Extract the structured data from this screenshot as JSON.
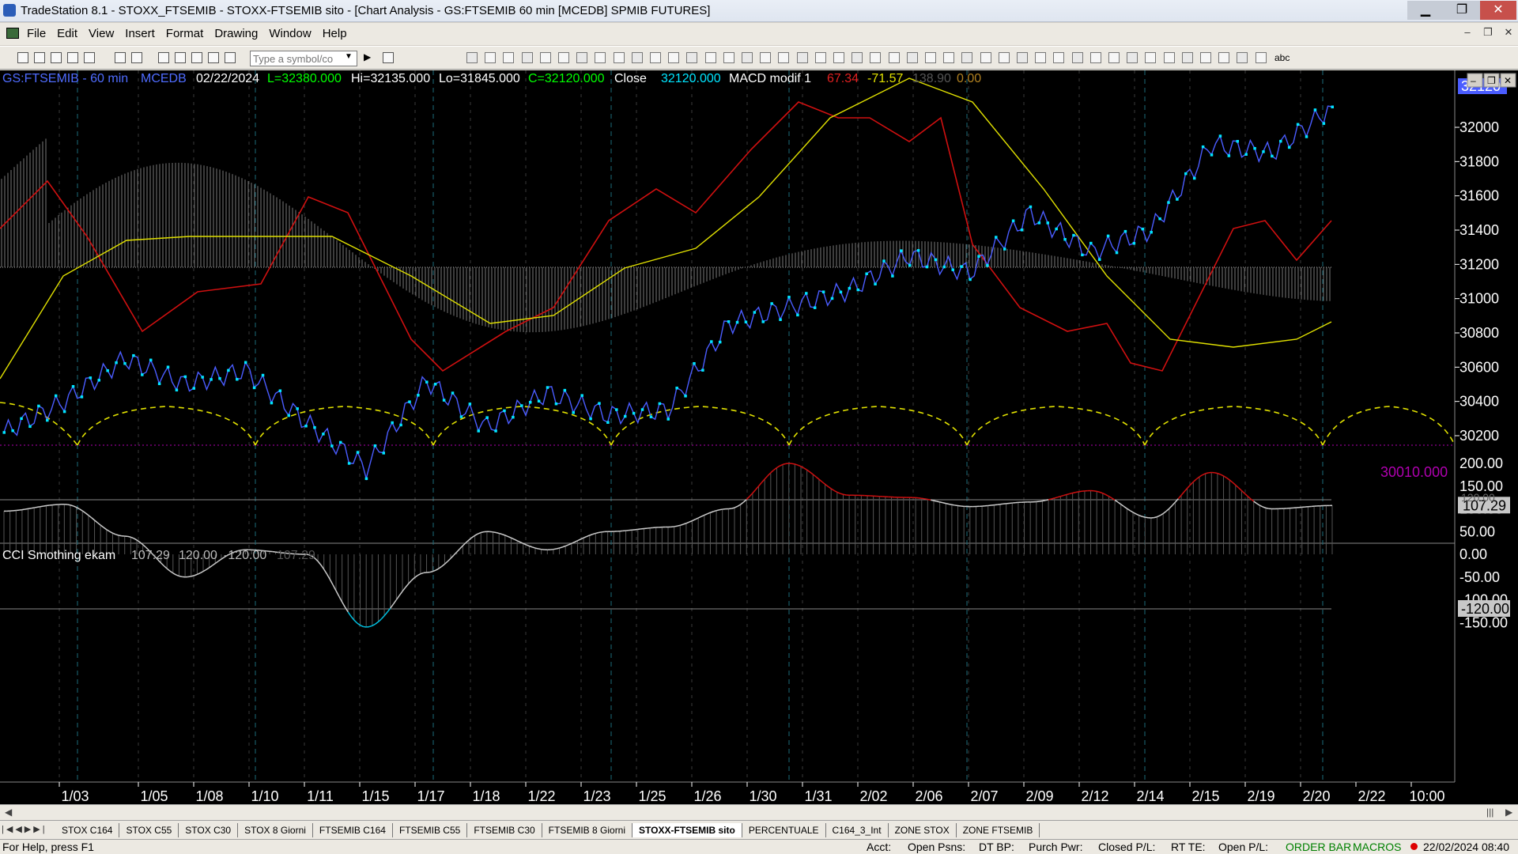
{
  "window": {
    "title": "TradeStation 8.1 - STOXX_FTSEMIB - STOXX-FTSEMIB sito - [Chart Analysis - GS:FTSEMIB  60 min  [MCEDB] SPMIB FUTURES]",
    "min": "▁",
    "max": "❐",
    "close": "✕"
  },
  "menu": {
    "items": [
      "File",
      "Edit",
      "View",
      "Insert",
      "Format",
      "Drawing",
      "Window",
      "Help"
    ],
    "mdi_min": "–",
    "mdi_restore": "❐",
    "mdi_close": "✕"
  },
  "toolbar": {
    "symbol_placeholder": "Type a symbol/co",
    "text_tool": "abc"
  },
  "chart": {
    "header": {
      "symbol": "GS:FTSEMIB - 60 min",
      "feed": "MCEDB",
      "date": "02/22/2024",
      "last": "L=32380.000",
      "high": "Hi=32135.000",
      "low": "Lo=31845.000",
      "close_eq": "C=32120.000",
      "close_label": "Close",
      "close_value": "32120.000",
      "macd_name": "MACD modif 1",
      "macd_v1": "67.34",
      "macd_v2": "-71.57",
      "macd_v3": "138.90",
      "macd_v4": "0.00",
      "cci_name": "CCI Smothing ekam",
      "cci_v1": "107.29",
      "cci_v2": "120.00",
      "cci_v3": "-120.00",
      "cci_v4": "107.29"
    },
    "colors": {
      "price": "#4a5cff",
      "dots": "#00e5ff",
      "macd_line": "#d01010",
      "signal_line": "#e0e000",
      "hist": "#7a7a7a",
      "cycle": "#e0e000",
      "cci_hi": "#d01010",
      "cci_lo": "#00c0e0"
    },
    "price_axis": [
      "32000",
      "31800",
      "31600",
      "31400",
      "31200",
      "31000",
      "30800",
      "30600",
      "30400",
      "30200"
    ],
    "price_last": "32120",
    "price_low_label": "30010.000",
    "cci_axis": [
      "200.00",
      "150.00",
      "100.00",
      "50.00",
      "0.00",
      "-50.00",
      "-100.00",
      "-150.00"
    ],
    "cci_hi_label": "120.00",
    "cci_last": "107.29",
    "cci_low_label": "-120.00",
    "date_axis": [
      "1/03",
      "1/05",
      "1/08",
      "1/10",
      "1/11",
      "1/15",
      "1/17",
      "1/18",
      "1/22",
      "1/23",
      "1/25",
      "1/26",
      "1/30",
      "1/31",
      "2/02",
      "2/06",
      "2/07",
      "2/09",
      "2/12",
      "2/14",
      "2/15",
      "2/19",
      "2/20",
      "2/22",
      "10:00"
    ]
  },
  "chart_data": {
    "type": "line",
    "title": "GS:FTSEMIB - 60 min",
    "x": [
      "1/03",
      "1/05",
      "1/08",
      "1/10",
      "1/11",
      "1/15",
      "1/17",
      "1/18",
      "1/22",
      "1/23",
      "1/25",
      "1/26",
      "1/30",
      "1/31",
      "2/02",
      "2/06",
      "2/07",
      "2/09",
      "2/12",
      "2/14",
      "2/15",
      "2/19",
      "2/20"
    ],
    "series": [
      {
        "name": "Close",
        "values": [
          30220,
          30400,
          30650,
          30500,
          30580,
          30280,
          30010,
          30520,
          30250,
          30450,
          30320,
          30350,
          30850,
          30950,
          31050,
          31250,
          31150,
          31500,
          31270,
          31400,
          31900,
          31850,
          32120
        ]
      }
    ],
    "ylim": [
      30010,
      32200
    ],
    "cci": {
      "name": "CCI Smothing ekam",
      "values": [
        95,
        110,
        40,
        -50,
        10,
        0,
        -160,
        -40,
        50,
        10,
        50,
        60,
        100,
        200,
        130,
        125,
        105,
        115,
        140,
        80,
        180,
        100,
        107.29
      ],
      "ylim": [
        -160,
        210
      ],
      "levels": [
        120,
        -120
      ]
    }
  }
}
